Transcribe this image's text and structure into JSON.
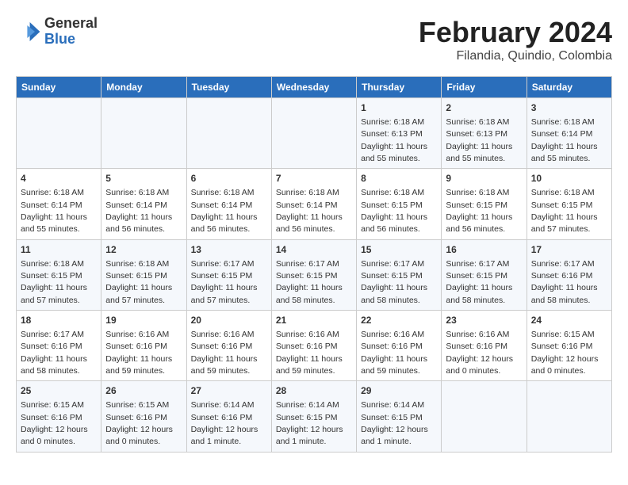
{
  "header": {
    "logo_general": "General",
    "logo_blue": "Blue",
    "main_title": "February 2024",
    "subtitle": "Filandia, Quindio, Colombia"
  },
  "days_of_week": [
    "Sunday",
    "Monday",
    "Tuesday",
    "Wednesday",
    "Thursday",
    "Friday",
    "Saturday"
  ],
  "weeks": [
    [
      {
        "day": "",
        "info": ""
      },
      {
        "day": "",
        "info": ""
      },
      {
        "day": "",
        "info": ""
      },
      {
        "day": "",
        "info": ""
      },
      {
        "day": "1",
        "info": "Sunrise: 6:18 AM\nSunset: 6:13 PM\nDaylight: 11 hours\nand 55 minutes."
      },
      {
        "day": "2",
        "info": "Sunrise: 6:18 AM\nSunset: 6:13 PM\nDaylight: 11 hours\nand 55 minutes."
      },
      {
        "day": "3",
        "info": "Sunrise: 6:18 AM\nSunset: 6:14 PM\nDaylight: 11 hours\nand 55 minutes."
      }
    ],
    [
      {
        "day": "4",
        "info": "Sunrise: 6:18 AM\nSunset: 6:14 PM\nDaylight: 11 hours\nand 55 minutes."
      },
      {
        "day": "5",
        "info": "Sunrise: 6:18 AM\nSunset: 6:14 PM\nDaylight: 11 hours\nand 56 minutes."
      },
      {
        "day": "6",
        "info": "Sunrise: 6:18 AM\nSunset: 6:14 PM\nDaylight: 11 hours\nand 56 minutes."
      },
      {
        "day": "7",
        "info": "Sunrise: 6:18 AM\nSunset: 6:14 PM\nDaylight: 11 hours\nand 56 minutes."
      },
      {
        "day": "8",
        "info": "Sunrise: 6:18 AM\nSunset: 6:15 PM\nDaylight: 11 hours\nand 56 minutes."
      },
      {
        "day": "9",
        "info": "Sunrise: 6:18 AM\nSunset: 6:15 PM\nDaylight: 11 hours\nand 56 minutes."
      },
      {
        "day": "10",
        "info": "Sunrise: 6:18 AM\nSunset: 6:15 PM\nDaylight: 11 hours\nand 57 minutes."
      }
    ],
    [
      {
        "day": "11",
        "info": "Sunrise: 6:18 AM\nSunset: 6:15 PM\nDaylight: 11 hours\nand 57 minutes."
      },
      {
        "day": "12",
        "info": "Sunrise: 6:18 AM\nSunset: 6:15 PM\nDaylight: 11 hours\nand 57 minutes."
      },
      {
        "day": "13",
        "info": "Sunrise: 6:17 AM\nSunset: 6:15 PM\nDaylight: 11 hours\nand 57 minutes."
      },
      {
        "day": "14",
        "info": "Sunrise: 6:17 AM\nSunset: 6:15 PM\nDaylight: 11 hours\nand 58 minutes."
      },
      {
        "day": "15",
        "info": "Sunrise: 6:17 AM\nSunset: 6:15 PM\nDaylight: 11 hours\nand 58 minutes."
      },
      {
        "day": "16",
        "info": "Sunrise: 6:17 AM\nSunset: 6:15 PM\nDaylight: 11 hours\nand 58 minutes."
      },
      {
        "day": "17",
        "info": "Sunrise: 6:17 AM\nSunset: 6:16 PM\nDaylight: 11 hours\nand 58 minutes."
      }
    ],
    [
      {
        "day": "18",
        "info": "Sunrise: 6:17 AM\nSunset: 6:16 PM\nDaylight: 11 hours\nand 58 minutes."
      },
      {
        "day": "19",
        "info": "Sunrise: 6:16 AM\nSunset: 6:16 PM\nDaylight: 11 hours\nand 59 minutes."
      },
      {
        "day": "20",
        "info": "Sunrise: 6:16 AM\nSunset: 6:16 PM\nDaylight: 11 hours\nand 59 minutes."
      },
      {
        "day": "21",
        "info": "Sunrise: 6:16 AM\nSunset: 6:16 PM\nDaylight: 11 hours\nand 59 minutes."
      },
      {
        "day": "22",
        "info": "Sunrise: 6:16 AM\nSunset: 6:16 PM\nDaylight: 11 hours\nand 59 minutes."
      },
      {
        "day": "23",
        "info": "Sunrise: 6:16 AM\nSunset: 6:16 PM\nDaylight: 12 hours\nand 0 minutes."
      },
      {
        "day": "24",
        "info": "Sunrise: 6:15 AM\nSunset: 6:16 PM\nDaylight: 12 hours\nand 0 minutes."
      }
    ],
    [
      {
        "day": "25",
        "info": "Sunrise: 6:15 AM\nSunset: 6:16 PM\nDaylight: 12 hours\nand 0 minutes."
      },
      {
        "day": "26",
        "info": "Sunrise: 6:15 AM\nSunset: 6:16 PM\nDaylight: 12 hours\nand 0 minutes."
      },
      {
        "day": "27",
        "info": "Sunrise: 6:14 AM\nSunset: 6:16 PM\nDaylight: 12 hours\nand 1 minute."
      },
      {
        "day": "28",
        "info": "Sunrise: 6:14 AM\nSunset: 6:15 PM\nDaylight: 12 hours\nand 1 minute."
      },
      {
        "day": "29",
        "info": "Sunrise: 6:14 AM\nSunset: 6:15 PM\nDaylight: 12 hours\nand 1 minute."
      },
      {
        "day": "",
        "info": ""
      },
      {
        "day": "",
        "info": ""
      }
    ]
  ]
}
